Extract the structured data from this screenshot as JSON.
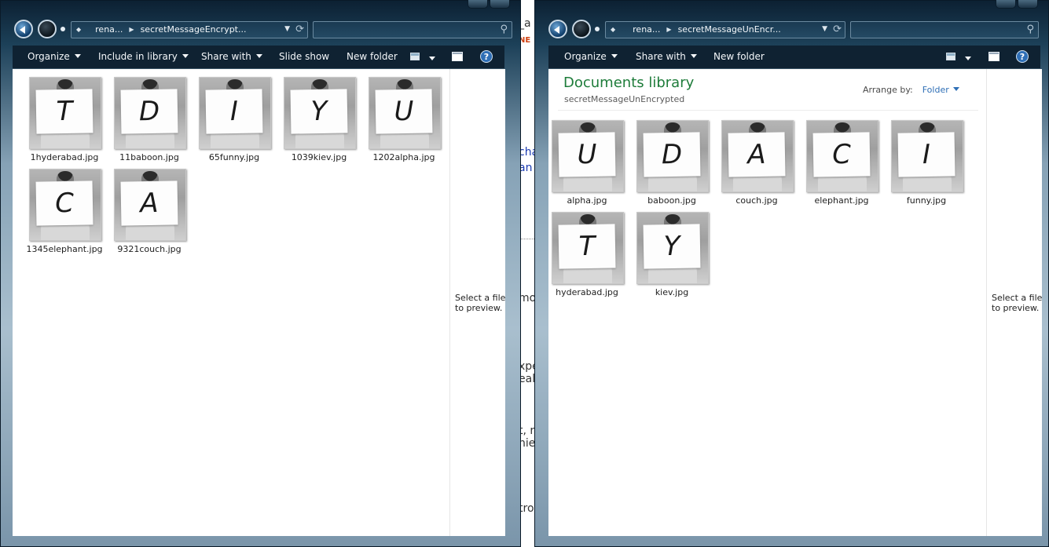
{
  "background": {
    "fragments": [
      "_a",
      "NE",
      "cha",
      "an",
      "mo",
      "xpe",
      "eal",
      "t, r",
      "hie",
      "tro"
    ]
  },
  "left_window": {
    "breadcrumbs": [
      "rena...",
      "secretMessageEncrypt..."
    ],
    "toolbar": {
      "organize": "Organize",
      "include": "Include in library",
      "share": "Share with",
      "slideshow": "Slide show",
      "newfolder": "New folder",
      "help": "?"
    },
    "files": [
      {
        "name": "1hyderabad.jpg",
        "letter": "T"
      },
      {
        "name": "11baboon.jpg",
        "letter": "D"
      },
      {
        "name": "65funny.jpg",
        "letter": "I"
      },
      {
        "name": "1039kiev.jpg",
        "letter": "Y"
      },
      {
        "name": "1202alpha.jpg",
        "letter": "U"
      },
      {
        "name": "1345elephant.jpg",
        "letter": "C"
      },
      {
        "name": "9321couch.jpg",
        "letter": "A"
      }
    ],
    "preview_text": "Select a file to preview."
  },
  "right_window": {
    "breadcrumbs": [
      "rena...",
      "secretMessageUnEncr..."
    ],
    "toolbar": {
      "organize": "Organize",
      "share": "Share with",
      "newfolder": "New folder",
      "help": "?"
    },
    "library_title": "Documents library",
    "library_subtitle": "secretMessageUnEncrypted",
    "arrange_label": "Arrange by:",
    "arrange_value": "Folder",
    "files": [
      {
        "name": "alpha.jpg",
        "letter": "U"
      },
      {
        "name": "baboon.jpg",
        "letter": "D"
      },
      {
        "name": "couch.jpg",
        "letter": "A"
      },
      {
        "name": "elephant.jpg",
        "letter": "C"
      },
      {
        "name": "funny.jpg",
        "letter": "I"
      },
      {
        "name": "hyderabad.jpg",
        "letter": "T"
      },
      {
        "name": "kiev.jpg",
        "letter": "Y"
      }
    ],
    "preview_text": "Select a file to preview."
  },
  "icons": {
    "back": "back-arrow-icon",
    "forward": "forward-arrow-icon",
    "refresh": "refresh-icon",
    "search": "search-icon",
    "views": "views-icon",
    "preview_pane": "preview-pane-icon",
    "help": "help-icon"
  }
}
